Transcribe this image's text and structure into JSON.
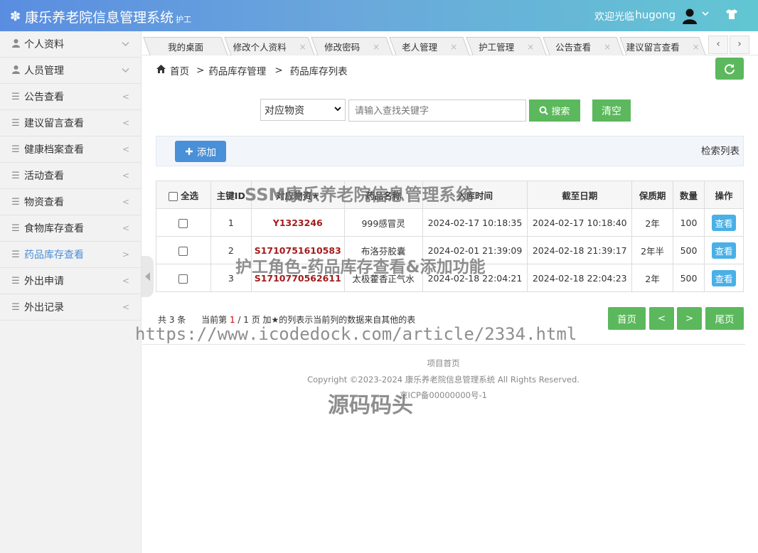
{
  "header": {
    "title": "康乐养老院信息管理系统",
    "role": "护工",
    "welcome": "欢迎光临",
    "username": "hugong"
  },
  "sidebar": {
    "items": [
      {
        "label": "个人资料",
        "icon": "user-icon",
        "arrow": "chevron-down-icon"
      },
      {
        "label": "人员管理",
        "icon": "user-icon",
        "arrow": "chevron-down-icon"
      },
      {
        "label": "公告查看",
        "icon": "menu-icon",
        "arrow": "chevron-left-icon"
      },
      {
        "label": "建议留言查看",
        "icon": "menu-icon",
        "arrow": "chevron-left-icon"
      },
      {
        "label": "健康档案查看",
        "icon": "menu-icon",
        "arrow": "chevron-left-icon"
      },
      {
        "label": "活动查看",
        "icon": "menu-icon",
        "arrow": "chevron-left-icon"
      },
      {
        "label": "物资查看",
        "icon": "menu-icon",
        "arrow": "chevron-left-icon"
      },
      {
        "label": "食物库存查看",
        "icon": "menu-icon",
        "arrow": "chevron-left-icon"
      },
      {
        "label": "药品库存查看",
        "icon": "menu-icon",
        "arrow": "chevron-right-icon",
        "active": true
      },
      {
        "label": "外出申请",
        "icon": "menu-icon",
        "arrow": "chevron-left-icon"
      },
      {
        "label": "外出记录",
        "icon": "menu-icon",
        "arrow": "chevron-left-icon"
      }
    ]
  },
  "tabs": [
    "我的桌面",
    "修改个人资料",
    "修改密码",
    "老人管理",
    "护工管理",
    "公告查看",
    "建议留言查看"
  ],
  "breadcrumb": {
    "home": "首页",
    "level1": "药品库存管理",
    "level2": "药品库存列表"
  },
  "search": {
    "select_value": "对应物资",
    "placeholder": "请输入查找关键字",
    "search_label": "搜索",
    "clear_label": "清空"
  },
  "actions": {
    "add_label": "添加",
    "retrieve_label": "检索列表"
  },
  "table": {
    "headers": [
      "全选",
      "主键ID",
      "对应物资★",
      "药品名称",
      "入库时间",
      "截至日期",
      "保质期",
      "数量",
      "操作"
    ],
    "rows": [
      {
        "id": "1",
        "material": "Y1323246",
        "name": "999感冒灵",
        "in_time": "2024-02-17 10:18:35",
        "expire": "2024-02-17 10:18:40",
        "shelf": "2年",
        "qty": "100",
        "action": "查看"
      },
      {
        "id": "2",
        "material": "S1710751610583",
        "name": "布洛芬胶囊",
        "in_time": "2024-02-01 21:39:09",
        "expire": "2024-02-18 21:39:17",
        "shelf": "2年半",
        "qty": "500",
        "action": "查看"
      },
      {
        "id": "3",
        "material": "S1710770562611",
        "name": "太极藿香正气水",
        "in_time": "2024-02-18 22:04:21",
        "expire": "2024-02-18 22:04:23",
        "shelf": "2年",
        "qty": "500",
        "action": "查看"
      }
    ]
  },
  "pagination": {
    "total_prefix": "共 3 条",
    "current_prefix": "当前第",
    "current_page": "1",
    "total_suffix": "/ 1 页",
    "note": "加★的列表示当前列的数据来自其他的表",
    "first": "首页",
    "prev": "<",
    "next": ">",
    "last": "尾页"
  },
  "footer": {
    "line1": "项目首页",
    "line2": "Copyright ©2023-2024 康乐养老院信息管理系统 All Rights Reserved.",
    "line3": "京ICP备00000000号-1"
  },
  "watermarks": {
    "w1": "SSM康乐养老院信息管理系统",
    "w2": "护工角色-药品库存查看&添加功能",
    "w3": "https://www.icodedock.com/article/2334.html",
    "w4": "源码码头"
  },
  "colors": {
    "accent_blue": "#4a90d9",
    "green": "#5cb85c",
    "code_red": "#a41c1c"
  }
}
